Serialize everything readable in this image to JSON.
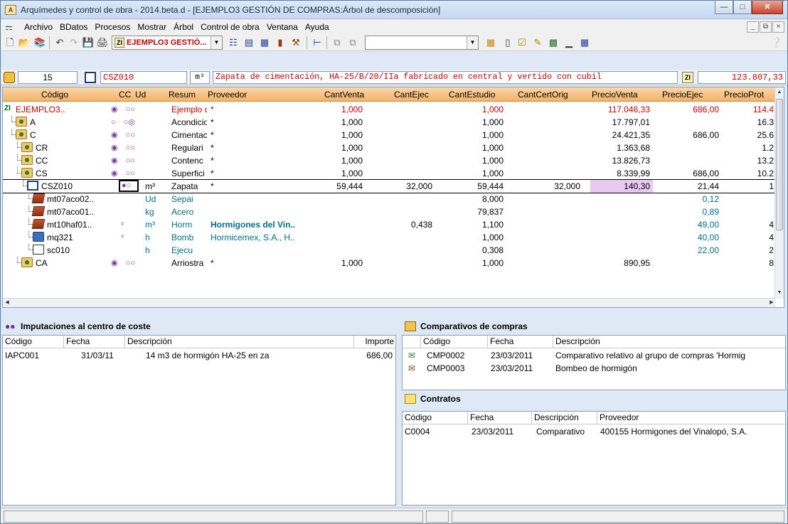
{
  "window": {
    "title": "Arquímedes y control de obra - 2014.beta.d - [EJEMPLO3 GESTIÓN DE COMPRAS:Árbol de descomposición]"
  },
  "menu": [
    "Archivo",
    "BDatos",
    "Procesos",
    "Mostrar",
    "Árbol",
    "Control de obra",
    "Ventana",
    "Ayuda"
  ],
  "toolbar": {
    "project_combo": "EJEMPLO3 GESTIÓ...",
    "project_icon": "ZI"
  },
  "record": {
    "quantity": "15",
    "code": "CSZ010",
    "unit": "m³",
    "summary": "Zapata de cimentación, HA-25/B/20/IIa fabricado en central y vertido con cubil",
    "total": "123.807,33"
  },
  "grid": {
    "columns": [
      "Código",
      "CC",
      "Ud",
      "Resum",
      "Proveedor",
      "CantVenta",
      "CantEjec",
      "CantEstudio",
      "CantCertOrig",
      "PrecioVenta",
      "PrecioEjec",
      "PrecioProt"
    ],
    "rows": [
      {
        "code": "EJEMPLO3..",
        "cc": "",
        "ud": "",
        "res": "Ejemplo de",
        "prov": "*",
        "cv": "1,000",
        "ce": "",
        "cest": "1,000",
        "ccert": "",
        "pv": "117.046,33",
        "pe": "686,00",
        "pp": "114.4"
      },
      {
        "code": "A",
        "cc": "",
        "ud": "",
        "res": "Acondicioi",
        "prov": "*",
        "cv": "1,000",
        "ce": "",
        "cest": "1,000",
        "ccert": "",
        "pv": "17.797,01",
        "pe": "",
        "pp": "16.3"
      },
      {
        "code": "C",
        "cc": "",
        "ud": "",
        "res": "Cimentaci",
        "prov": "*",
        "cv": "1,000",
        "ce": "",
        "cest": "1,000",
        "ccert": "",
        "pv": "24.421,35",
        "pe": "686,00",
        "pp": "25.6"
      },
      {
        "code": "CR",
        "cc": "",
        "ud": "",
        "res": "Regulari",
        "prov": "*",
        "cv": "1,000",
        "ce": "",
        "cest": "1,000",
        "ccert": "",
        "pv": "1.363,68",
        "pe": "",
        "pp": "1.2"
      },
      {
        "code": "CC",
        "cc": "",
        "ud": "",
        "res": "Contenc",
        "prov": "*",
        "cv": "1,000",
        "ce": "",
        "cest": "1,000",
        "ccert": "",
        "pv": "13.826,73",
        "pe": "",
        "pp": "13.2"
      },
      {
        "code": "CS",
        "cc": "",
        "ud": "",
        "res": "Superfici",
        "prov": "*",
        "cv": "1,000",
        "ce": "",
        "cest": "1,000",
        "ccert": "",
        "pv": "8.339,99",
        "pe": "686,00",
        "pp": "10.2"
      },
      {
        "code": "CSZ010",
        "cc": "",
        "ud": "m³",
        "res": "Zapata",
        "prov": "*",
        "cv": "59,444",
        "ce": "32,000",
        "cest": "59,444",
        "ccert": "32,000",
        "pv": "140,30",
        "pe": "21,44",
        "pp": "1"
      },
      {
        "code": "mt07aco02..",
        "cc": "",
        "ud": "Ud",
        "res": "Sepai",
        "prov": "",
        "cv": "",
        "ce": "",
        "cest": "8,000",
        "ccert": "",
        "pv": "",
        "pe": "0,12",
        "pp": ""
      },
      {
        "code": "mt07aco01..",
        "cc": "",
        "ud": "kg",
        "res": "Acero",
        "prov": "",
        "cv": "",
        "ce": "",
        "cest": "79,837",
        "ccert": "",
        "pv": "",
        "pe": "0,89",
        "pp": ""
      },
      {
        "code": "mt10haf01..",
        "cc": "",
        "ud": "m³",
        "res": "Horm",
        "prov": "Hormigones del Vin..",
        "cv": "",
        "ce": "0,438",
        "cest": "1,100",
        "ccert": "",
        "pv": "",
        "pe": "49,00",
        "pp": "4"
      },
      {
        "code": "mq321",
        "cc": "",
        "ud": "h",
        "res": "Bomb",
        "prov": "Hormicemex, S.A., H..",
        "cv": "",
        "ce": "",
        "cest": "1,000",
        "ccert": "",
        "pv": "",
        "pe": "40,00",
        "pp": "4"
      },
      {
        "code": "sc010",
        "cc": "",
        "ud": "h",
        "res": "Ejecu",
        "prov": "",
        "cv": "",
        "ce": "",
        "cest": "0,308",
        "ccert": "",
        "pv": "",
        "pe": "22,00",
        "pp": "2"
      },
      {
        "code": "CA",
        "cc": "",
        "ud": "",
        "res": "Arriostra",
        "prov": "*",
        "cv": "1,000",
        "ce": "",
        "cest": "1,000",
        "ccert": "",
        "pv": "890,95",
        "pe": "",
        "pp": "8"
      }
    ]
  },
  "imputaciones": {
    "title": "Imputaciones al centro de coste",
    "columns": [
      "Código",
      "Fecha",
      "Descripción",
      "Importe"
    ],
    "rows": [
      {
        "code": "IAPC001",
        "date": "31/03/11",
        "desc": "14 m3 de hormigón HA-25 en za",
        "amount": "686,00"
      }
    ]
  },
  "comparativos": {
    "title": "Comparativos de compras",
    "columns": [
      "Código",
      "Fecha",
      "Descripción"
    ],
    "rows": [
      {
        "code": "CMP0002",
        "date": "23/03/2011",
        "desc": "Comparativo relativo al grupo de compras 'Hormig"
      },
      {
        "code": "CMP0003",
        "date": "23/03/2011",
        "desc": "Bombeo de hormigón"
      }
    ]
  },
  "contratos": {
    "title": "Contratos",
    "columns": [
      "Código",
      "Fecha",
      "Descripción",
      "Proveedor"
    ],
    "rows": [
      {
        "code": "C0004",
        "date": "23/03/2011",
        "desc": "Comparativo",
        "prov": "400155 Hormigones del Vinalopó, S.A."
      }
    ]
  },
  "colors": {
    "header_orange": "#f3b26a",
    "accent_red": "#c00000",
    "link_teal": "#006e8f",
    "selected_pink": "#e8c9f2"
  }
}
